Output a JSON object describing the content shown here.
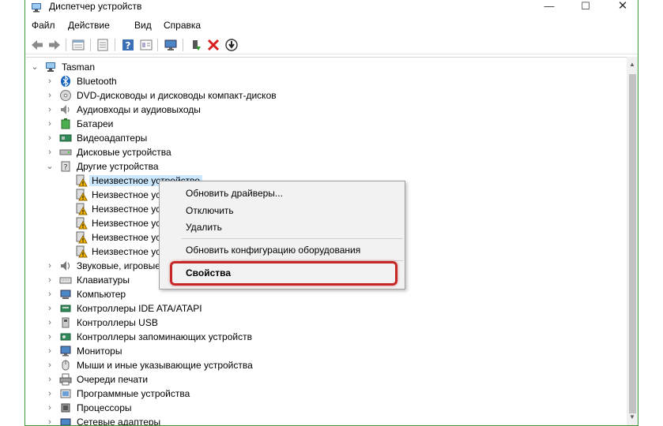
{
  "window": {
    "title": "Диспетчер устройств",
    "controls": {
      "minimize": "—",
      "maximize": "☐",
      "close": "✕"
    }
  },
  "menu": [
    "Файл",
    "Действие",
    "Вид",
    "Справка"
  ],
  "toolbar": [
    "back-icon",
    "forward-icon",
    "properties-icon",
    "list-icon",
    "help-icon",
    "details-icon",
    "monitor-icon",
    "update-driver-icon",
    "uninstall-icon",
    "disable-icon"
  ],
  "tree": {
    "root": "Tasman",
    "items": [
      {
        "label": "Bluetooth",
        "icon": "bluetooth-icon"
      },
      {
        "label": "DVD-дисководы и дисководы компакт-дисков",
        "icon": "dvd-drive-icon"
      },
      {
        "label": "Аудиовходы и аудиовыходы",
        "icon": "audio-icon"
      },
      {
        "label": "Батареи",
        "icon": "battery-icon"
      },
      {
        "label": "Видеоадаптеры",
        "icon": "display-adapter-icon"
      },
      {
        "label": "Дисковые устройства",
        "icon": "disk-drive-icon"
      },
      {
        "label": "Другие устройства",
        "icon": "other-devices-icon"
      },
      {
        "label": "Неизвестное устройство",
        "icon": "unknown-device-icon"
      },
      {
        "label": "Неизвестное устро",
        "icon": "unknown-device-icon"
      },
      {
        "label": "Неизвестное устро",
        "icon": "unknown-device-icon"
      },
      {
        "label": "Неизвестное устро",
        "icon": "unknown-device-icon"
      },
      {
        "label": "Неизвестное устро",
        "icon": "unknown-device-icon"
      },
      {
        "label": "Неизвестное устро",
        "icon": "unknown-device-icon"
      },
      {
        "label": "Звуковые, игровые",
        "icon": "sound-icon"
      },
      {
        "label": "Клавиатуры",
        "icon": "keyboard-icon"
      },
      {
        "label": "Компьютер",
        "icon": "computer-icon"
      },
      {
        "label": "Контроллеры IDE ATA/ATAPI",
        "icon": "ide-controller-icon"
      },
      {
        "label": "Контроллеры USB",
        "icon": "usb-controller-icon"
      },
      {
        "label": "Контроллеры запоминающих устройств",
        "icon": "storage-controller-icon"
      },
      {
        "label": "Мониторы",
        "icon": "monitor-icon"
      },
      {
        "label": "Мыши и иные указывающие устройства",
        "icon": "mouse-icon"
      },
      {
        "label": "Очереди печати",
        "icon": "print-queue-icon"
      },
      {
        "label": "Программные устройства",
        "icon": "software-device-icon"
      },
      {
        "label": "Процессоры",
        "icon": "processor-icon"
      },
      {
        "label": "Сетевые адаптеры",
        "icon": "network-adapter-icon"
      }
    ]
  },
  "context_menu": {
    "update": "Обновить драйверы...",
    "disable": "Отключить",
    "uninstall": "Удалить",
    "scan": "Обновить конфигурацию оборудования",
    "properties": "Свойства"
  },
  "colors": {
    "highlight": "#c62828",
    "selection": "#cce8ff",
    "window_border": "#3c9a3c"
  }
}
